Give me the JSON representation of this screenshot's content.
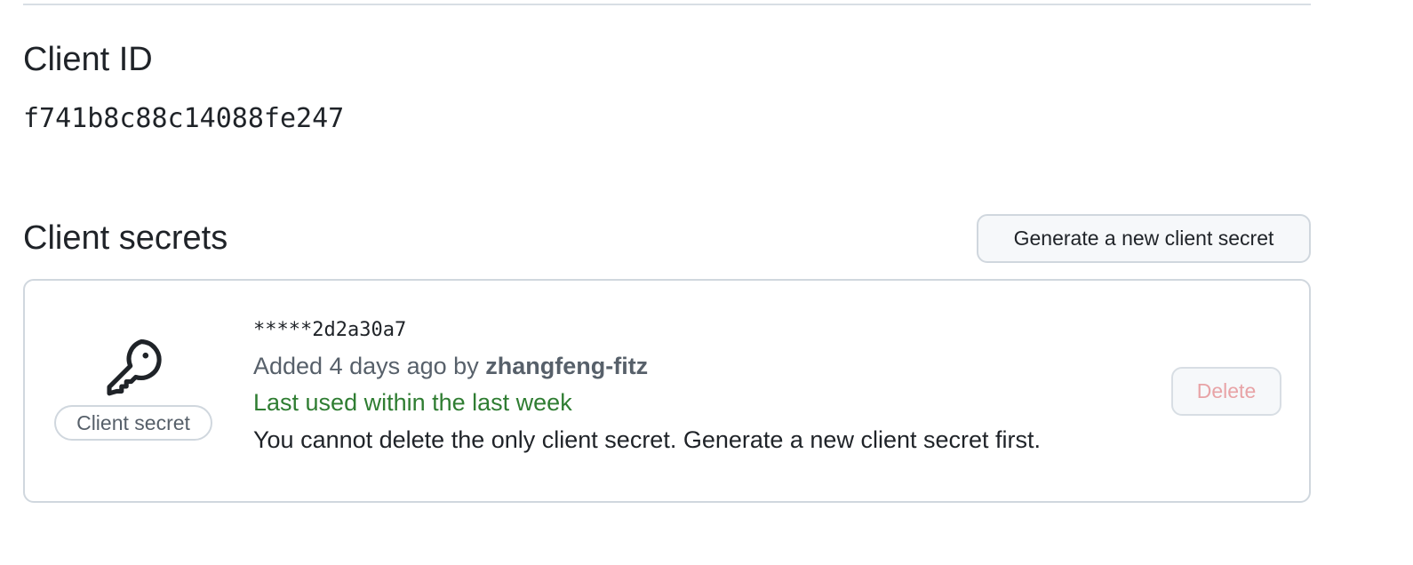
{
  "client_id": {
    "heading": "Client ID",
    "value": "f741b8c88c14088fe247"
  },
  "client_secrets": {
    "heading": "Client secrets",
    "generate_button_label": "Generate a new client secret",
    "secret": {
      "icon": "key-icon",
      "badge_label": "Client secret",
      "masked_value": "*****2d2a30a7",
      "added_prefix": "Added 4 days ago by",
      "added_by": "zhangfeng-fitz",
      "last_used": "Last used within the last week",
      "delete_note": "You cannot delete the only client secret. Generate a new client secret first.",
      "delete_button_label": "Delete"
    }
  },
  "colors": {
    "text_primary": "#1f2328",
    "text_muted": "#57606a",
    "success": "#2f7d32",
    "danger_disabled": "#e8a3a6",
    "border": "#d0d7de",
    "button_bg": "#f6f8fa"
  }
}
